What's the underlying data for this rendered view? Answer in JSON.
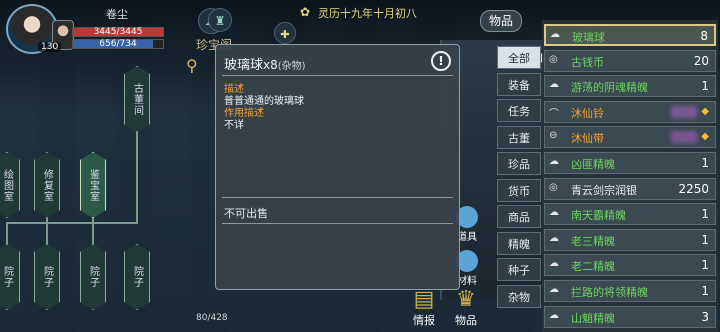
{
  "player": {
    "name": "卷尘",
    "level": "130",
    "hp_text": "3445/3445",
    "hp_fraction": 1.0,
    "mp_text": "656/734",
    "mp_fraction": 0.894
  },
  "calendar": {
    "date": "灵历十九年十月初八"
  },
  "map": {
    "title": "珍宝阁",
    "nodes": [
      "古董间",
      "绘图室",
      "修复室",
      "鉴宝室",
      "院子",
      "院子",
      "院子",
      "院子"
    ]
  },
  "tooltip": {
    "item_name": "玻璃球",
    "count": "x8",
    "category": "(杂物)",
    "desc_label": "描述",
    "desc_text": "普普通通的玻璃球",
    "effect_label": "作用描述",
    "effect_text": "不详",
    "sale_text": "不可出售",
    "close_icon": "!"
  },
  "bottom": {
    "count_text": "80/428",
    "intel_label": "情报",
    "items_label": "物品",
    "props_label": "道具",
    "materials_label": "材料"
  },
  "inventory": {
    "header": "物品",
    "tabs": [
      "全部",
      "装备",
      "任务",
      "古董",
      "珍品",
      "货币",
      "商品",
      "精魄",
      "种子",
      "杂物"
    ],
    "active_tab": "全部",
    "items": [
      {
        "name": "玻璃球",
        "qty": "8",
        "quality": "green",
        "icon": "pile-icon",
        "selected": true
      },
      {
        "name": "古钱币",
        "qty": "20",
        "quality": "green",
        "icon": "coin-icon"
      },
      {
        "name": "游荡的阴魂精魄",
        "qty": "1",
        "quality": "green",
        "icon": "soul-icon"
      },
      {
        "name": "沐仙铃",
        "qty": "",
        "quality": "orange",
        "icon": "bell-icon",
        "gem": true
      },
      {
        "name": "沐仙带",
        "qty": "",
        "quality": "orange",
        "icon": "belt-icon",
        "gem": true
      },
      {
        "name": "凶匪精魄",
        "qty": "1",
        "quality": "green",
        "icon": "soul-icon"
      },
      {
        "name": "青云剑宗润银",
        "qty": "2250",
        "quality": "white",
        "icon": "coin-icon"
      },
      {
        "name": "南天霸精魄",
        "qty": "1",
        "quality": "green",
        "icon": "soul-icon"
      },
      {
        "name": "老三精魄",
        "qty": "1",
        "quality": "green",
        "icon": "soul-icon"
      },
      {
        "name": "老二精魄",
        "qty": "1",
        "quality": "green",
        "icon": "soul-icon"
      },
      {
        "name": "拦路的将领精魄",
        "qty": "1",
        "quality": "green",
        "icon": "soul-icon"
      },
      {
        "name": "山魈精魄",
        "qty": "3",
        "quality": "green",
        "icon": "soul-icon"
      }
    ]
  },
  "colors": {
    "green": "#6fd35f",
    "orange": "#f1a22d",
    "white": "#ececec"
  }
}
